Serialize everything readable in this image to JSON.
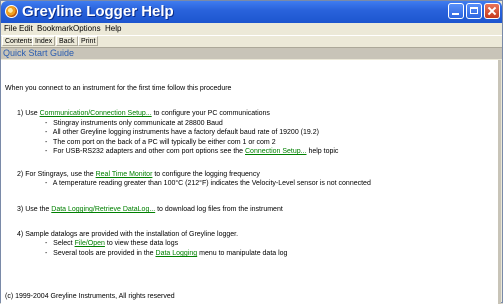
{
  "window": {
    "title": "Greyline Logger Help"
  },
  "menu": [
    "File",
    "Edit",
    "Bookmark",
    "Options",
    "Help"
  ],
  "toolbar": [
    "Contents",
    "Index",
    "Back",
    "Print"
  ],
  "banner": "Quick Start Guide",
  "content": {
    "intro": "When you connect to an instrument for the first time follow this procedure",
    "step1": {
      "num": "1)",
      "pre": "Use ",
      "link": "Communication/Connection Setup...",
      "post": " to configure your PC communications",
      "bullets": [
        "Stingray instruments only communicate at 28800 Baud",
        "All other Greyline logging instruments have a factory default baud rate of 19200 (19.2)",
        "The com port on the back of a PC will typically be either com 1 or com 2"
      ],
      "bullet4_pre": "For USB-RS232 adapters and other com port options see the ",
      "bullet4_link": "Connection Setup...",
      "bullet4_post": " help topic"
    },
    "step2": {
      "num": "2)",
      "pre": "For Stingrays,  use the ",
      "link": "Real Time Monitor",
      "post": " to configure the logging frequency",
      "bullet": "A temperature reading greater than 100°C (212°F) indicates the Velocity-Level sensor is not connected"
    },
    "step3": {
      "num": "3)",
      "pre": "Use the ",
      "link": "Data Logging/Retrieve DataLog...",
      "post": " to download log files from the instrument"
    },
    "step4": {
      "num": "4)",
      "text": "Sample datalogs are provided with the installation of Greyline logger.",
      "b1_pre": "Select ",
      "b1_link": "File/Open",
      "b1_post": " to view these data logs",
      "b2_pre": "Several tools are provided in the ",
      "b2_link": "Data Logging",
      "b2_post": " menu to manipulate data log"
    },
    "footer": "(c) 1999-2004 Greyline Instruments, All rights reserved"
  }
}
